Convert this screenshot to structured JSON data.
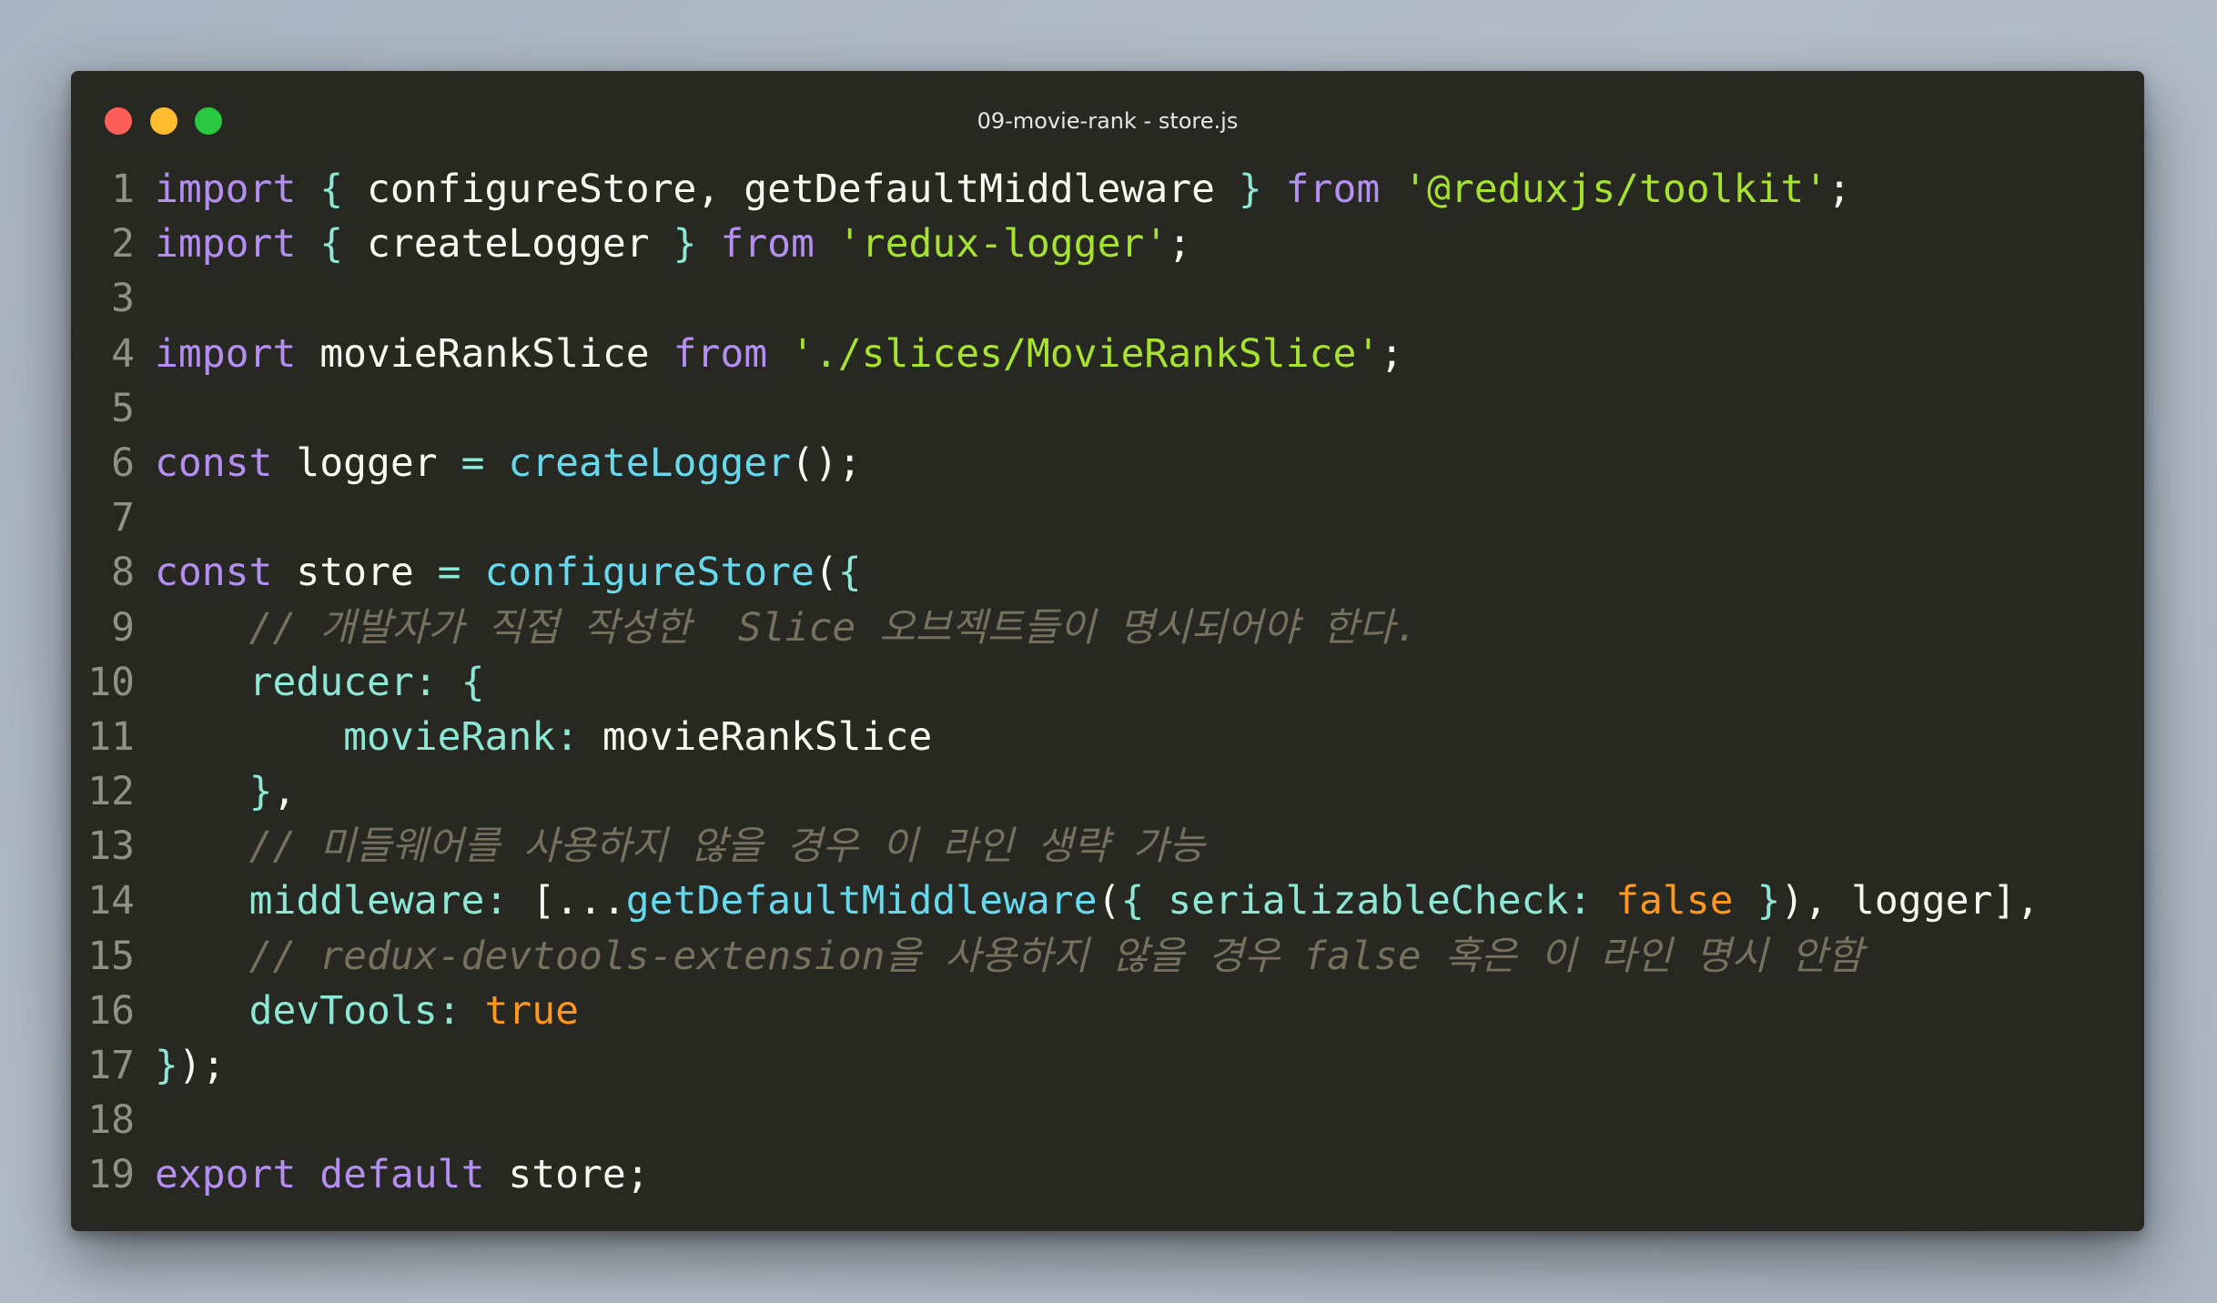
{
  "window": {
    "title": "09-movie-rank - store.js"
  },
  "colors": {
    "keyword": "#b48ef0",
    "string": "#a6e22e",
    "function": "#66d9ef",
    "comment": "#75715e",
    "boolean": "#fd971f",
    "property": "#8de7d4",
    "text": "#f8f8f2",
    "background": "#272822"
  },
  "lines": [
    {
      "n": "1",
      "tokens": [
        {
          "t": "import",
          "c": "k"
        },
        {
          "t": " ",
          "c": "p"
        },
        {
          "t": "{",
          "c": "pr"
        },
        {
          "t": " configureStore, getDefaultMiddleware ",
          "c": "p"
        },
        {
          "t": "}",
          "c": "pr"
        },
        {
          "t": " ",
          "c": "p"
        },
        {
          "t": "from",
          "c": "k"
        },
        {
          "t": " ",
          "c": "p"
        },
        {
          "t": "'@reduxjs/toolkit'",
          "c": "s"
        },
        {
          "t": ";",
          "c": "p"
        }
      ]
    },
    {
      "n": "2",
      "tokens": [
        {
          "t": "import",
          "c": "k"
        },
        {
          "t": " ",
          "c": "p"
        },
        {
          "t": "{",
          "c": "pr"
        },
        {
          "t": " createLogger ",
          "c": "p"
        },
        {
          "t": "}",
          "c": "pr"
        },
        {
          "t": " ",
          "c": "p"
        },
        {
          "t": "from",
          "c": "k"
        },
        {
          "t": " ",
          "c": "p"
        },
        {
          "t": "'redux-logger'",
          "c": "s"
        },
        {
          "t": ";",
          "c": "p"
        }
      ]
    },
    {
      "n": "3",
      "tokens": []
    },
    {
      "n": "4",
      "tokens": [
        {
          "t": "import",
          "c": "k"
        },
        {
          "t": " movieRankSlice ",
          "c": "p"
        },
        {
          "t": "from",
          "c": "k"
        },
        {
          "t": " ",
          "c": "p"
        },
        {
          "t": "'./slices/MovieRankSlice'",
          "c": "s"
        },
        {
          "t": ";",
          "c": "p"
        }
      ]
    },
    {
      "n": "5",
      "tokens": []
    },
    {
      "n": "6",
      "tokens": [
        {
          "t": "const",
          "c": "k"
        },
        {
          "t": " logger ",
          "c": "p"
        },
        {
          "t": "=",
          "c": "pr"
        },
        {
          "t": " ",
          "c": "p"
        },
        {
          "t": "createLogger",
          "c": "f"
        },
        {
          "t": "();",
          "c": "p"
        }
      ]
    },
    {
      "n": "7",
      "tokens": []
    },
    {
      "n": "8",
      "tokens": [
        {
          "t": "const",
          "c": "k"
        },
        {
          "t": " store ",
          "c": "p"
        },
        {
          "t": "=",
          "c": "pr"
        },
        {
          "t": " ",
          "c": "p"
        },
        {
          "t": "configureStore",
          "c": "f"
        },
        {
          "t": "(",
          "c": "p"
        },
        {
          "t": "{",
          "c": "pr"
        }
      ]
    },
    {
      "n": "9",
      "tokens": [
        {
          "t": "    ",
          "c": "p"
        },
        {
          "t": "// 개발자가 직접 작성한  Slice 오브젝트들이 명시되어야 한다.",
          "c": "c"
        }
      ]
    },
    {
      "n": "10",
      "tokens": [
        {
          "t": "    ",
          "c": "p"
        },
        {
          "t": "reducer",
          "c": "pr"
        },
        {
          "t": ":",
          "c": "pr"
        },
        {
          "t": " ",
          "c": "p"
        },
        {
          "t": "{",
          "c": "pr"
        }
      ]
    },
    {
      "n": "11",
      "tokens": [
        {
          "t": "        ",
          "c": "p"
        },
        {
          "t": "movieRank",
          "c": "pr"
        },
        {
          "t": ":",
          "c": "pr"
        },
        {
          "t": " movieRankSlice",
          "c": "p"
        }
      ]
    },
    {
      "n": "12",
      "tokens": [
        {
          "t": "    ",
          "c": "p"
        },
        {
          "t": "}",
          "c": "pr"
        },
        {
          "t": ",",
          "c": "p"
        }
      ]
    },
    {
      "n": "13",
      "tokens": [
        {
          "t": "    ",
          "c": "p"
        },
        {
          "t": "// 미들웨어를 사용하지 않을 경우 이 라인 생략 가능",
          "c": "c"
        }
      ]
    },
    {
      "n": "14",
      "tokens": [
        {
          "t": "    ",
          "c": "p"
        },
        {
          "t": "middleware",
          "c": "pr"
        },
        {
          "t": ":",
          "c": "pr"
        },
        {
          "t": " [...",
          "c": "p"
        },
        {
          "t": "getDefaultMiddleware",
          "c": "f"
        },
        {
          "t": "(",
          "c": "p"
        },
        {
          "t": "{",
          "c": "pr"
        },
        {
          "t": " ",
          "c": "p"
        },
        {
          "t": "serializableCheck",
          "c": "pr"
        },
        {
          "t": ":",
          "c": "pr"
        },
        {
          "t": " ",
          "c": "p"
        },
        {
          "t": "false",
          "c": "o"
        },
        {
          "t": " ",
          "c": "p"
        },
        {
          "t": "}",
          "c": "pr"
        },
        {
          "t": "), logger],",
          "c": "p"
        }
      ]
    },
    {
      "n": "15",
      "tokens": [
        {
          "t": "    ",
          "c": "p"
        },
        {
          "t": "// redux-devtools-extension을 사용하지 않을 경우 false 혹은 이 라인 명시 안함",
          "c": "c"
        }
      ]
    },
    {
      "n": "16",
      "tokens": [
        {
          "t": "    ",
          "c": "p"
        },
        {
          "t": "devTools",
          "c": "pr"
        },
        {
          "t": ":",
          "c": "pr"
        },
        {
          "t": " ",
          "c": "p"
        },
        {
          "t": "true",
          "c": "o"
        }
      ]
    },
    {
      "n": "17",
      "tokens": [
        {
          "t": "}",
          "c": "pr"
        },
        {
          "t": ");",
          "c": "p"
        }
      ]
    },
    {
      "n": "18",
      "tokens": []
    },
    {
      "n": "19",
      "tokens": [
        {
          "t": "export",
          "c": "k"
        },
        {
          "t": " ",
          "c": "p"
        },
        {
          "t": "default",
          "c": "k"
        },
        {
          "t": " store;",
          "c": "p"
        }
      ]
    }
  ]
}
